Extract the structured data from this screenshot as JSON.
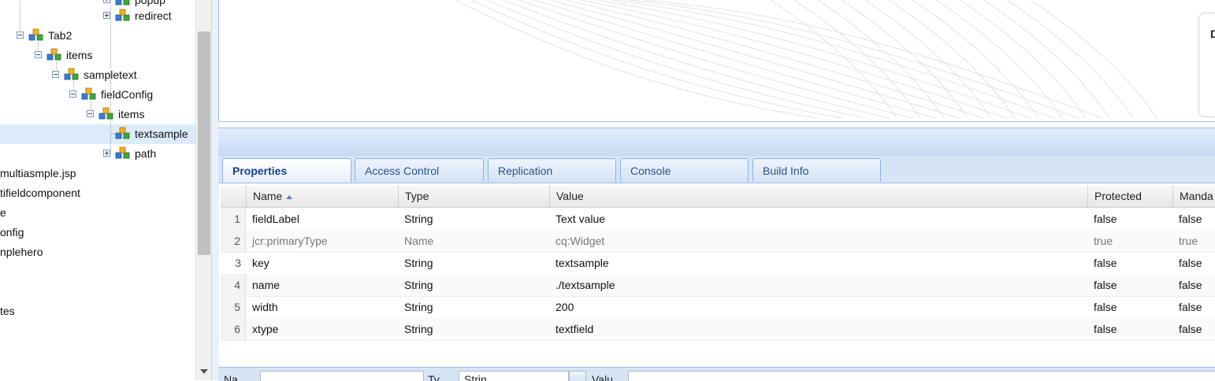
{
  "tree": {
    "nodes": [
      {
        "label": "popup",
        "expander": "plus"
      },
      {
        "label": "redirect",
        "expander": "plus"
      },
      {
        "label": "Tab2",
        "expander": "minus"
      },
      {
        "label": "items",
        "expander": "minus"
      },
      {
        "label": "sampletext",
        "expander": "minus"
      },
      {
        "label": "fieldConfig",
        "expander": "minus"
      },
      {
        "label": "items",
        "expander": "minus"
      },
      {
        "label": "textsample",
        "expander": "none",
        "selected": true
      },
      {
        "label": "path",
        "expander": "plus"
      }
    ],
    "cut_items": [
      "multiasmple.jsp",
      "tifieldcomponent",
      "e",
      "onfig",
      "nplehero",
      "tes"
    ]
  },
  "tabs": [
    {
      "label": "Properties",
      "active": true
    },
    {
      "label": "Access Control",
      "active": false
    },
    {
      "label": "Replication",
      "active": false
    },
    {
      "label": "Console",
      "active": false
    },
    {
      "label": "Build Info",
      "active": false
    }
  ],
  "grid": {
    "columns": [
      "Name",
      "Type",
      "Value",
      "Protected",
      "Manda"
    ],
    "sort_column": "Name",
    "sort_direction": "asc",
    "rows": [
      {
        "num": "1",
        "name": "fieldLabel",
        "type": "String",
        "value": "Text value",
        "protected": "false",
        "mandatory": "false"
      },
      {
        "num": "2",
        "name": "jcr:primaryType",
        "type": "Name",
        "value": "cq:Widget",
        "protected": "true",
        "mandatory": "true"
      },
      {
        "num": "3",
        "name": "key",
        "type": "String",
        "value": "textsample",
        "protected": "false",
        "mandatory": "false"
      },
      {
        "num": "4",
        "name": "name",
        "type": "String",
        "value": "./textsample",
        "protected": "false",
        "mandatory": "false"
      },
      {
        "num": "5",
        "name": "width",
        "type": "String",
        "value": "200",
        "protected": "false",
        "mandatory": "false"
      },
      {
        "num": "6",
        "name": "xtype",
        "type": "String",
        "value": "textfield",
        "protected": "false",
        "mandatory": "false"
      }
    ],
    "highlighted_row": "3",
    "highlight_color": "#ffff05"
  },
  "editor": {
    "side_label": "D"
  },
  "bottom_form": {
    "name_label": "Na",
    "type_label": "Ty",
    "type_value": "Strin",
    "value_label": "Valu"
  }
}
